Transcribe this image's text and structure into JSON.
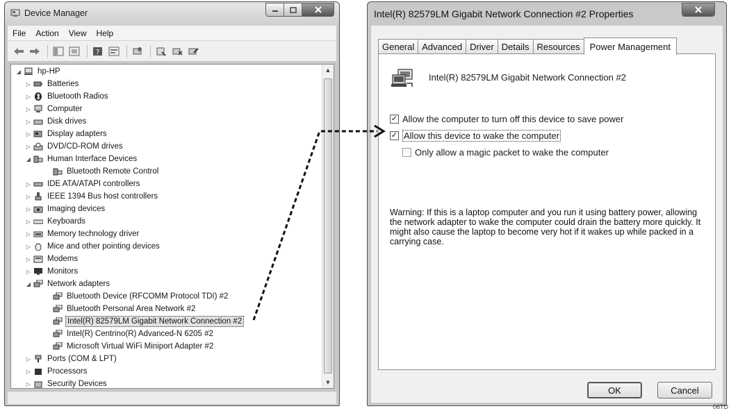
{
  "device_manager": {
    "title": "Device Manager",
    "menu": [
      "File",
      "Action",
      "View",
      "Help"
    ],
    "tree": [
      {
        "label": "hp-HP",
        "level": 0,
        "expander": "◢",
        "icon": "computer-root-icon"
      },
      {
        "label": "Batteries",
        "level": 1,
        "expander": "▷",
        "icon": "battery-icon"
      },
      {
        "label": "Bluetooth Radios",
        "level": 1,
        "expander": "▷",
        "icon": "bluetooth-icon"
      },
      {
        "label": "Computer",
        "level": 1,
        "expander": "▷",
        "icon": "computer-icon"
      },
      {
        "label": "Disk drives",
        "level": 1,
        "expander": "▷",
        "icon": "disk-drive-icon"
      },
      {
        "label": "Display adapters",
        "level": 1,
        "expander": "▷",
        "icon": "display-adapter-icon"
      },
      {
        "label": "DVD/CD-ROM drives",
        "level": 1,
        "expander": "▷",
        "icon": "dvd-drive-icon"
      },
      {
        "label": "Human Interface Devices",
        "level": 1,
        "expander": "◢",
        "icon": "hid-icon"
      },
      {
        "label": "Bluetooth Remote Control",
        "level": 2,
        "expander": "",
        "icon": "hid-icon"
      },
      {
        "label": "IDE ATA/ATAPI controllers",
        "level": 1,
        "expander": "▷",
        "icon": "ide-controller-icon"
      },
      {
        "label": "IEEE 1394 Bus host controllers",
        "level": 1,
        "expander": "▷",
        "icon": "ieee1394-icon"
      },
      {
        "label": "Imaging devices",
        "level": 1,
        "expander": "▷",
        "icon": "imaging-device-icon"
      },
      {
        "label": "Keyboards",
        "level": 1,
        "expander": "▷",
        "icon": "keyboard-icon"
      },
      {
        "label": "Memory technology driver",
        "level": 1,
        "expander": "▷",
        "icon": "memory-icon"
      },
      {
        "label": "Mice and other pointing devices",
        "level": 1,
        "expander": "▷",
        "icon": "mouse-icon"
      },
      {
        "label": "Modems",
        "level": 1,
        "expander": "▷",
        "icon": "modem-icon"
      },
      {
        "label": "Monitors",
        "level": 1,
        "expander": "▷",
        "icon": "monitor-icon"
      },
      {
        "label": "Network adapters",
        "level": 1,
        "expander": "◢",
        "icon": "network-adapter-icon"
      },
      {
        "label": "Bluetooth Device (RFCOMM Protocol TDI) #2",
        "level": 2,
        "expander": "",
        "icon": "network-adapter-icon"
      },
      {
        "label": "Bluetooth Personal Area Network #2",
        "level": 2,
        "expander": "",
        "icon": "network-adapter-icon"
      },
      {
        "label": "Intel(R) 82579LM Gigabit Network Connection #2",
        "level": 2,
        "expander": "",
        "icon": "network-adapter-icon",
        "selected": true
      },
      {
        "label": "Intel(R) Centrino(R) Advanced-N 6205 #2",
        "level": 2,
        "expander": "",
        "icon": "network-adapter-icon"
      },
      {
        "label": "Microsoft Virtual WiFi Miniport Adapter #2",
        "level": 2,
        "expander": "",
        "icon": "network-adapter-icon"
      },
      {
        "label": "Ports (COM & LPT)",
        "level": 1,
        "expander": "▷",
        "icon": "port-icon"
      },
      {
        "label": "Processors",
        "level": 1,
        "expander": "▷",
        "icon": "processor-icon"
      },
      {
        "label": "Security Devices",
        "level": 1,
        "expander": "▷",
        "icon": "security-device-icon"
      }
    ]
  },
  "properties": {
    "title": "Intel(R) 82579LM Gigabit Network Connection #2 Properties",
    "tabs": [
      "General",
      "Advanced",
      "Driver",
      "Details",
      "Resources",
      "Power Management"
    ],
    "active_tab": "Power Management",
    "device_name": "Intel(R) 82579LM Gigabit Network Connection #2",
    "options": [
      {
        "label": "Allow the computer to turn off this device to save power",
        "checked": true
      },
      {
        "label": "Allow this device to wake the computer",
        "checked": true
      },
      {
        "label": "Only allow a magic packet to wake the computer",
        "checked": false
      }
    ],
    "warning": "Warning: If this is a laptop computer and you run it using battery power, allowing the network adapter to wake the computer could drain the battery more quickly. It might also cause the laptop to become very hot if it wakes up while packed in a carrying case.",
    "ok_label": "OK",
    "cancel_label": "Cancel"
  },
  "figure_code": "06TD"
}
